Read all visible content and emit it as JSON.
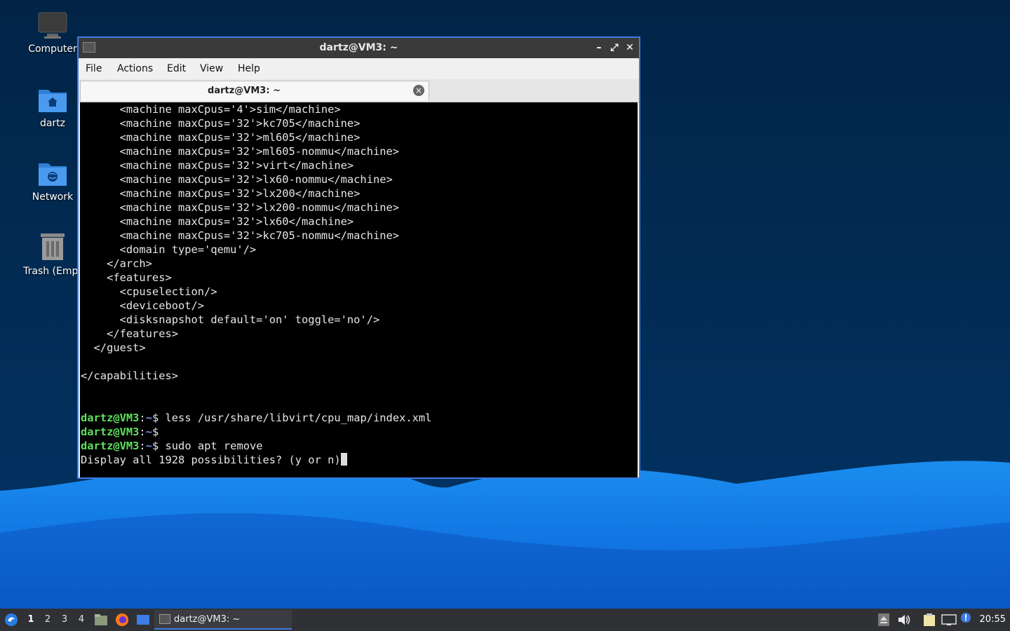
{
  "desktop": {
    "icons": [
      {
        "label": "Computer"
      },
      {
        "label": "dartz"
      },
      {
        "label": "Network"
      },
      {
        "label": "Trash (Empt"
      }
    ]
  },
  "window": {
    "title": "dartz@VM3: ~",
    "controls": {
      "minimize": "–",
      "maximize": "⤢",
      "close": "✕"
    },
    "menu": [
      "File",
      "Actions",
      "Edit",
      "View",
      "Help"
    ],
    "tab": {
      "label": "dartz@VM3: ~",
      "close": "×"
    }
  },
  "terminal": {
    "lines": [
      "      <machine maxCpus='4'>sim</machine>",
      "      <machine maxCpus='32'>kc705</machine>",
      "      <machine maxCpus='32'>ml605</machine>",
      "      <machine maxCpus='32'>ml605-nommu</machine>",
      "      <machine maxCpus='32'>virt</machine>",
      "      <machine maxCpus='32'>lx60-nommu</machine>",
      "      <machine maxCpus='32'>lx200</machine>",
      "      <machine maxCpus='32'>lx200-nommu</machine>",
      "      <machine maxCpus='32'>lx60</machine>",
      "      <machine maxCpus='32'>kc705-nommu</machine>",
      "      <domain type='qemu'/>",
      "    </arch>",
      "    <features>",
      "      <cpuselection/>",
      "      <deviceboot/>",
      "      <disksnapshot default='on' toggle='no'/>",
      "    </features>",
      "  </guest>",
      "",
      "</capabilities>",
      "",
      ""
    ],
    "prompt_user": "dartz@VM3",
    "prompt_sep": ":",
    "prompt_path": "~",
    "prompt_dollar": "$",
    "commands": [
      " less /usr/share/libvirt/cpu_map/index.xml",
      "",
      " sudo apt remove"
    ],
    "last_line": "Display all 1928 possibilities? (y or n)"
  },
  "taskbar": {
    "workspaces": [
      "1",
      "2",
      "3",
      "4"
    ],
    "active_workspace": "1",
    "task_label": "dartz@VM3: ~",
    "clock": "20:55"
  }
}
